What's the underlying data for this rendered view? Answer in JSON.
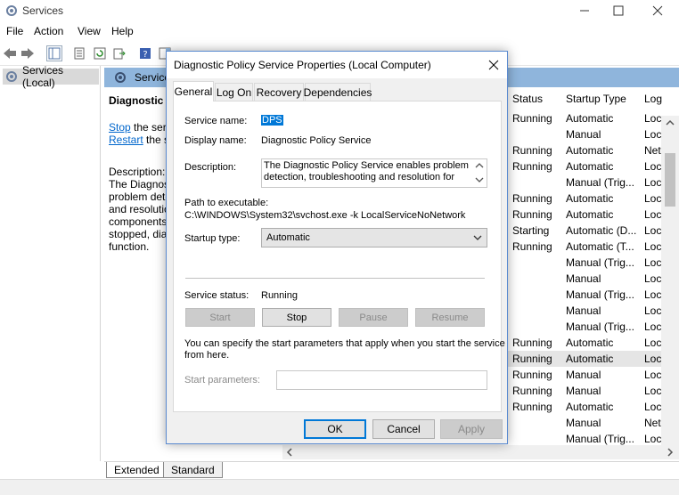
{
  "window": {
    "title": "Services",
    "controls": {
      "minimize": "—",
      "maximize": "☐",
      "close": "✕"
    }
  },
  "menu": {
    "file": "File",
    "action": "Action",
    "view": "View",
    "help": "Help"
  },
  "tree": {
    "root": "Services (Local)"
  },
  "panel": {
    "header": "Services",
    "service_title": "Diagnostic P",
    "stop_link": "Stop",
    "stop_suffix": " the serv",
    "restart_link": "Restart",
    "restart_suffix": " the se",
    "description_label": "Description:",
    "description_lines": [
      "The Diagnos",
      "problem dete",
      "and resolutio",
      "components",
      "stopped, diag",
      "function."
    ]
  },
  "columns": {
    "status": "Status",
    "startup_type": "Startup Type",
    "log_on": "Log"
  },
  "rows": [
    {
      "status": "Running",
      "startup": "Automatic",
      "logon": "Loc"
    },
    {
      "status": "",
      "startup": "Manual",
      "logon": "Loc"
    },
    {
      "status": "Running",
      "startup": "Automatic",
      "logon": "Net"
    },
    {
      "status": "Running",
      "startup": "Automatic",
      "logon": "Loc"
    },
    {
      "status": "",
      "startup": "Manual (Trig...",
      "logon": "Loc"
    },
    {
      "status": "Running",
      "startup": "Automatic",
      "logon": "Loc"
    },
    {
      "status": "Running",
      "startup": "Automatic",
      "logon": "Loc"
    },
    {
      "status": "Starting",
      "startup": "Automatic (D...",
      "logon": "Loc"
    },
    {
      "status": "Running",
      "startup": "Automatic (T...",
      "logon": "Loc"
    },
    {
      "status": "",
      "startup": "Manual (Trig...",
      "logon": "Loc"
    },
    {
      "status": "",
      "startup": "Manual",
      "logon": "Loc"
    },
    {
      "status": "",
      "startup": "Manual (Trig...",
      "logon": "Loc"
    },
    {
      "status": "",
      "startup": "Manual",
      "logon": "Loc"
    },
    {
      "status": "",
      "startup": "Manual (Trig...",
      "logon": "Loc"
    },
    {
      "status": "Running",
      "startup": "Automatic",
      "logon": "Loc"
    },
    {
      "status": "Running",
      "startup": "Automatic",
      "logon": "Loc"
    },
    {
      "status": "Running",
      "startup": "Manual",
      "logon": "Loc"
    },
    {
      "status": "Running",
      "startup": "Manual",
      "logon": "Loc"
    },
    {
      "status": "Running",
      "startup": "Automatic",
      "logon": "Loc"
    },
    {
      "status": "",
      "startup": "Manual",
      "logon": "Net"
    },
    {
      "status": "",
      "startup": "Manual (Trig...",
      "logon": "Loc"
    }
  ],
  "bottom_tabs": {
    "extended": "Extended",
    "standard": "Standard"
  },
  "dialog": {
    "title": "Diagnostic Policy Service Properties (Local Computer)",
    "close": "✕",
    "tabs": {
      "general": "General",
      "logon": "Log On",
      "recovery": "Recovery",
      "dependencies": "Dependencies"
    },
    "service_name_label": "Service name:",
    "service_name": "DPS",
    "display_name_label": "Display name:",
    "display_name": "Diagnostic Policy Service",
    "description_label": "Description:",
    "description_lines": [
      "The Diagnostic Policy Service enables problem",
      "detection, troubleshooting and resolution for"
    ],
    "path_label": "Path to executable:",
    "path": "C:\\WINDOWS\\System32\\svchost.exe -k LocalServiceNoNetwork",
    "startup_type_label": "Startup type:",
    "startup_type": "Automatic",
    "status_label": "Service status:",
    "status": "Running",
    "buttons": {
      "start": "Start",
      "stop": "Stop",
      "pause": "Pause",
      "resume": "Resume"
    },
    "params_info_lines": [
      "You can specify the start parameters that apply when you start the service",
      "from here."
    ],
    "params_label": "Start parameters:",
    "params_value": "",
    "ok": "OK",
    "cancel": "Cancel",
    "apply": "Apply"
  },
  "colors": {
    "accent": "#0078d7",
    "header": "#8fb5dc",
    "link": "#0066cc",
    "selected_row": "#e5e5e5"
  }
}
